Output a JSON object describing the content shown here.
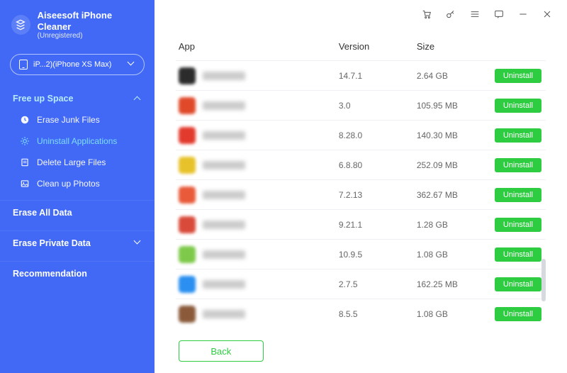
{
  "brand": {
    "title": "Aiseesoft iPhone Cleaner",
    "subtitle": "(Unregistered)"
  },
  "device": {
    "label": "iP...2)(iPhone XS Max)"
  },
  "sidebar": {
    "freeUpSpace": {
      "label": "Free up Space"
    },
    "items": [
      {
        "label": "Erase Junk Files"
      },
      {
        "label": "Uninstall Applications"
      },
      {
        "label": "Delete Large Files"
      },
      {
        "label": "Clean up Photos"
      }
    ],
    "eraseAll": {
      "label": "Erase All Data"
    },
    "erasePrivate": {
      "label": "Erase Private Data"
    },
    "recommendation": {
      "label": "Recommendation"
    }
  },
  "table": {
    "headers": {
      "app": "App",
      "version": "Version",
      "size": "Size"
    },
    "rows": [
      {
        "color": "#2c2c2c",
        "version": "14.7.1",
        "size": "2.64 GB"
      },
      {
        "color": "#e04a2b",
        "version": "3.0",
        "size": "105.95 MB"
      },
      {
        "color": "#e23b2e",
        "version": "8.28.0",
        "size": "140.30 MB"
      },
      {
        "color": "#e8c22a",
        "version": "6.8.80",
        "size": "252.09 MB"
      },
      {
        "color": "#e85a3a",
        "version": "7.2.13",
        "size": "362.67 MB"
      },
      {
        "color": "#d94a3a",
        "version": "9.21.1",
        "size": "1.28 GB"
      },
      {
        "color": "#7ec94a",
        "version": "10.9.5",
        "size": "1.08 GB"
      },
      {
        "color": "#2a8ff0",
        "version": "2.7.5",
        "size": "162.25 MB"
      },
      {
        "color": "#8a5a3a",
        "version": "8.5.5",
        "size": "1.08 GB"
      }
    ],
    "uninstallLabel": "Uninstall"
  },
  "footer": {
    "backLabel": "Back"
  }
}
